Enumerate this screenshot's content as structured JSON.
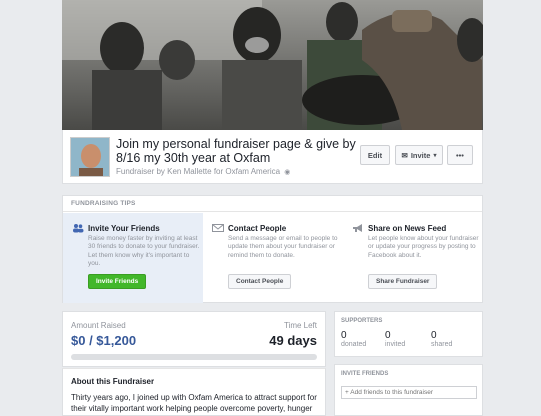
{
  "header": {
    "title": "Join my personal fundraiser page & give by 8/16 my 30th year at Oxfam",
    "subtitle": "Fundraiser by Ken Mallette for Oxfam America",
    "edit_label": "Edit",
    "invite_label": "Invite",
    "more_label": "•••"
  },
  "tips": {
    "heading": "FUNDRAISING TIPS",
    "items": [
      {
        "title": "Invite Your Friends",
        "body": "Raise money faster by inviting at least 30 friends to donate to your fundraiser. Let them know why it's important to you.",
        "button": "Invite Friends",
        "icon": "friends-icon"
      },
      {
        "title": "Contact People",
        "body": "Send a message or email to people to update them about your fundraiser or remind them to donate.",
        "button": "Contact People",
        "icon": "envelope-icon"
      },
      {
        "title": "Share on News Feed",
        "body": "Let people know about your fundraiser or update your progress by posting to Facebook about it.",
        "button": "Share Fundraiser",
        "icon": "megaphone-icon"
      }
    ]
  },
  "progress": {
    "amount_label": "Amount Raised",
    "amount_value": "$0 / $1,200",
    "time_label": "Time Left",
    "time_value": "49 days",
    "fraction": 0
  },
  "about": {
    "heading": "About this Fundraiser",
    "text": "Thirty years ago, I joined up with Oxfam America to attract support for their vitally important work helping people overcome poverty, hunger"
  },
  "supporters": {
    "heading": "SUPPORTERS",
    "stats": [
      {
        "value": "0",
        "label": "donated"
      },
      {
        "value": "0",
        "label": "invited"
      },
      {
        "value": "0",
        "label": "shared"
      }
    ]
  },
  "invite_friends": {
    "heading": "INVITE FRIENDS",
    "placeholder": "+ Add friends to this fundraiser"
  },
  "colors": {
    "accent": "#365899",
    "green": "#42b72a",
    "active_tip": "#e8eef7"
  }
}
